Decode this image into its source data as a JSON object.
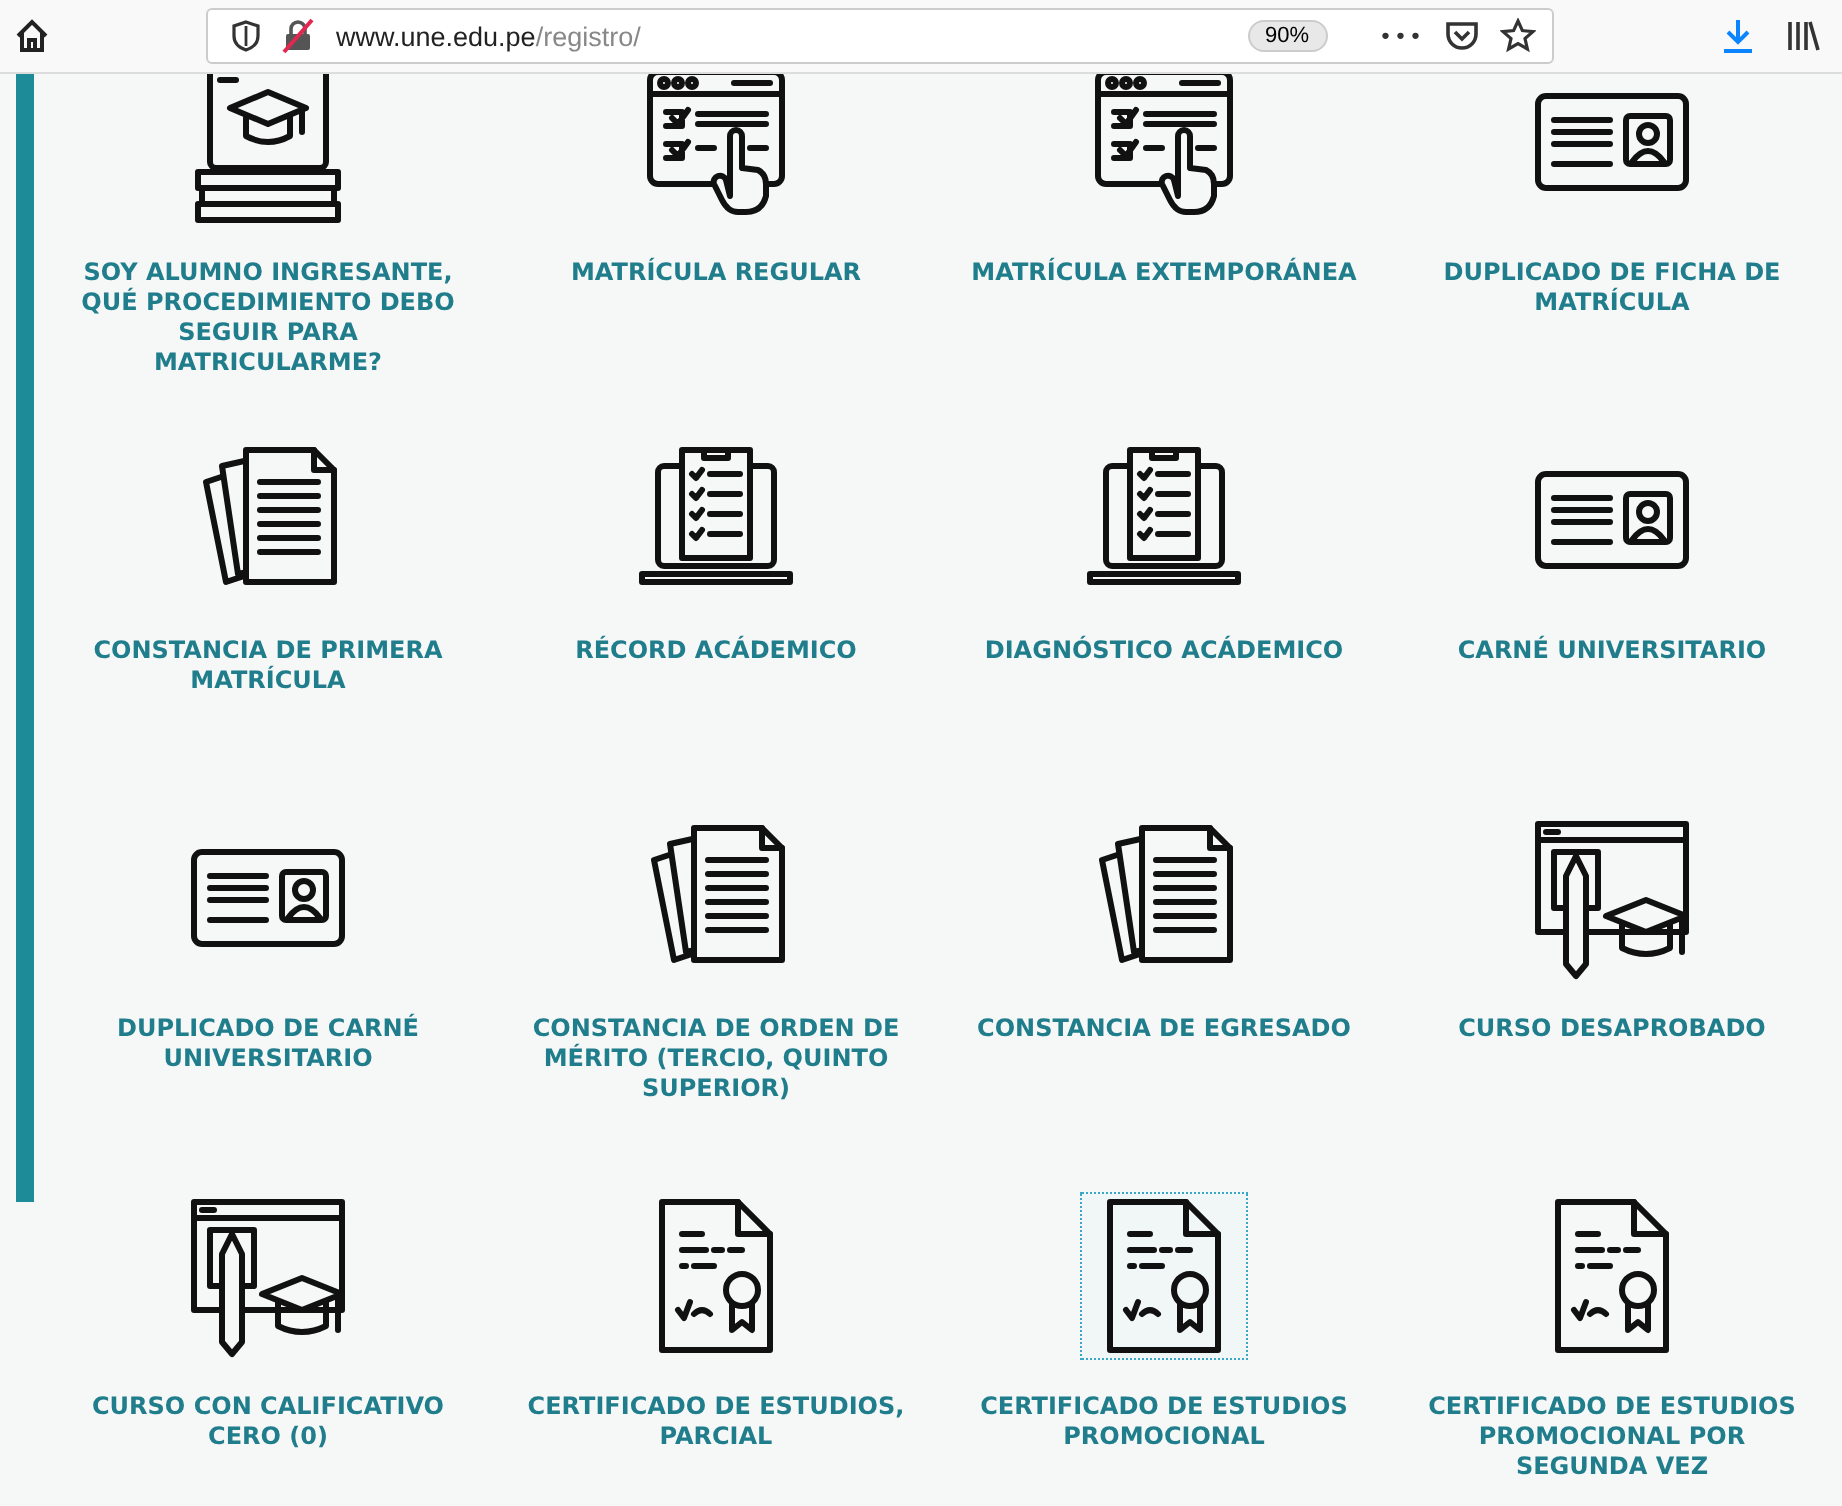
{
  "toolbar": {
    "url_host": "www.une.edu.pe",
    "url_path": "/registro/",
    "zoom": "90%",
    "more": "•••"
  },
  "items": [
    {
      "label": "SOY ALUMNO INGRESANTE, QUÉ PROCEDIMIENTO DEBO SEGUIR PARA MATRICULARME?",
      "kind": "grad-laptop",
      "focused": false
    },
    {
      "label": "MATRÍCULA REGULAR",
      "kind": "checklist",
      "focused": false
    },
    {
      "label": "MATRÍCULA EXTEMPORÁNEA",
      "kind": "checklist",
      "focused": false
    },
    {
      "label": "DUPLICADO DE FICHA DE MATRÍCULA",
      "kind": "id-card",
      "focused": false
    },
    {
      "label": "CONSTANCIA DE PRIMERA MATRÍCULA",
      "kind": "documents",
      "focused": false
    },
    {
      "label": "RÉCORD ACÁDEMICO",
      "kind": "laptop-list",
      "focused": false
    },
    {
      "label": "DIAGNÓSTICO ACÁDEMICO",
      "kind": "laptop-list",
      "focused": false
    },
    {
      "label": "CARNÉ UNIVERSITARIO",
      "kind": "id-card",
      "focused": false
    },
    {
      "label": "DUPLICADO DE CARNÉ UNIVERSITARIO",
      "kind": "id-card",
      "focused": false
    },
    {
      "label": "CONSTANCIA DE ORDEN DE MÉRITO (TERCIO, QUINTO SUPERIOR)",
      "kind": "documents",
      "focused": false
    },
    {
      "label": "CONSTANCIA DE EGRESADO",
      "kind": "documents",
      "focused": false
    },
    {
      "label": "CURSO DESAPROBADO",
      "kind": "course",
      "focused": false
    },
    {
      "label": "CURSO CON CALIFICATIVO CERO (0)",
      "kind": "course",
      "focused": false
    },
    {
      "label": "CERTIFICADO DE ESTUDIOS, PARCIAL",
      "kind": "certificate",
      "focused": false
    },
    {
      "label": "CERTIFICADO DE ESTUDIOS PROMOCIONAL",
      "kind": "certificate",
      "focused": true
    },
    {
      "label": "CERTIFICADO DE ESTUDIOS PROMOCIONAL POR SEGUNDA VEZ",
      "kind": "certificate",
      "focused": false
    }
  ]
}
